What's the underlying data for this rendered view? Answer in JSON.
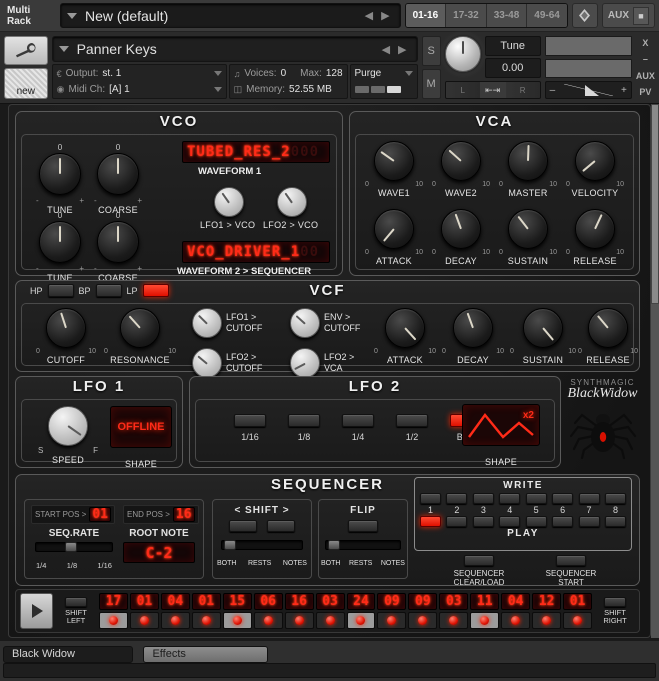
{
  "kontakt_header": {
    "multi_rack_line1": "Multi",
    "multi_rack_line2": "Rack",
    "preset_name": "New (default)",
    "prev_arrow": "◀",
    "next_arrow": "▶",
    "ranges": [
      "01-16",
      "17-32",
      "33-48",
      "49-64"
    ],
    "active_range": "01-16",
    "aux_label": "AUX"
  },
  "instrument_header": {
    "name": "Panner Keys",
    "output_key": "Output:",
    "output_value": "st. 1",
    "midi_key": "Midi Ch:",
    "midi_value": "[A] 1",
    "voices_key": "Voices:",
    "voices_value": "0",
    "max_key": "Max:",
    "max_value": "128",
    "memory_key": "Memory:",
    "memory_value": "52.55 MB",
    "purge_label": "Purge",
    "solo_label": "S",
    "mute_label": "M",
    "tune_label": "Tune",
    "tune_value": "0.00",
    "pan_left": "L",
    "pan_center": "⇤⇥",
    "pan_right": "R",
    "vol_minus": "–",
    "vol_plus": "+",
    "new_icon_label": "new",
    "rail": [
      "X",
      "–",
      "AUX",
      "PV"
    ]
  },
  "vco": {
    "title": "VCO",
    "knobs": [
      {
        "label": "TUNE",
        "top": "0",
        "min": "-",
        "max": "+"
      },
      {
        "label": "COARSE",
        "top": "0",
        "min": "-",
        "max": "+"
      },
      {
        "label": "TUNE",
        "top": "0",
        "min": "-",
        "max": "+"
      },
      {
        "label": "COARSE",
        "top": "0",
        "min": "-",
        "max": "+"
      }
    ],
    "display1": "TUBED_RES_2",
    "display1_dim": "000",
    "display1_label": "WAVEFORM 1",
    "display2": "VCO_DRIVER_1",
    "display2_dim": "00",
    "display2_label": "WAVEFORM 2  >  SEQUENCER",
    "mod_knobs": [
      {
        "label": "LFO1 > VCO"
      },
      {
        "label": "LFO2 > VCO"
      }
    ]
  },
  "vca": {
    "title": "VCA",
    "knobs": [
      {
        "label": "WAVE1",
        "min": "0",
        "max": "10"
      },
      {
        "label": "WAVE2",
        "min": "0",
        "max": "10"
      },
      {
        "label": "MASTER",
        "min": "0",
        "max": "10"
      },
      {
        "label": "VELOCITY",
        "min": "0",
        "max": "10"
      },
      {
        "label": "ATTACK",
        "min": "0",
        "max": "10"
      },
      {
        "label": "DECAY",
        "min": "0",
        "max": "10"
      },
      {
        "label": "SUSTAIN",
        "min": "0",
        "max": "10"
      },
      {
        "label": "RELEASE",
        "min": "0",
        "max": "10"
      }
    ]
  },
  "vcf": {
    "title": "VCF",
    "modes": [
      {
        "label": "HP",
        "on": false
      },
      {
        "label": "BP",
        "on": false
      },
      {
        "label": "LP",
        "on": true
      }
    ],
    "knobs": [
      {
        "label": "CUTOFF",
        "min": "0",
        "max": "10"
      },
      {
        "label": "RESONANCE",
        "min": "0",
        "max": "10"
      }
    ],
    "mod_knobs": [
      {
        "line1": "LFO1 >",
        "line2": "CUTOFF"
      },
      {
        "line1": "ENV >",
        "line2": "CUTOFF"
      },
      {
        "line1": "LFO2 >",
        "line2": "CUTOFF"
      },
      {
        "line1": "LFO2 >",
        "line2": "VCA"
      }
    ],
    "env_knobs": [
      {
        "label": "ATTACK",
        "min": "0",
        "max": "10"
      },
      {
        "label": "DECAY",
        "min": "0",
        "max": "10"
      },
      {
        "label": "SUSTAIN",
        "min": "0",
        "max": "10"
      },
      {
        "label": "RELEASE",
        "min": "0",
        "max": "10"
      }
    ]
  },
  "lfo1": {
    "title": "LFO 1",
    "speed_label": "SPEED",
    "speed_min": "S",
    "speed_max": "F",
    "shape_label": "SHAPE",
    "shape_value": "OFFLINE"
  },
  "lfo2": {
    "title": "LFO 2",
    "rates": [
      {
        "label": "1/16",
        "on": false
      },
      {
        "label": "1/8",
        "on": false
      },
      {
        "label": "1/4",
        "on": false
      },
      {
        "label": "1/2",
        "on": false
      },
      {
        "label": "BAR",
        "on": true
      }
    ],
    "shape_label": "SHAPE",
    "shape_multiplier": "x2"
  },
  "brand": {
    "company": "SYNTHMAGIC",
    "product": "BlackWidow"
  },
  "sequencer": {
    "title": "SEQUENCER",
    "start_pos_label": "START POS >",
    "start_pos_value": "01",
    "end_pos_label": "END POS >",
    "end_pos_value": "16",
    "seq_rate_label": "SEQ.RATE",
    "seq_rate_ticks": [
      "1/4",
      "1/8",
      "1/16"
    ],
    "root_note_label": "ROOT NOTE",
    "root_note_value": "C-2",
    "shift_label": "< SHIFT >",
    "flip_label": "FLIP",
    "mode_ticks": [
      "BOTH",
      "RESTS",
      "NOTES"
    ],
    "write_label": "WRITE",
    "play_label": "PLAY",
    "slot_numbers": [
      "1",
      "2",
      "3",
      "4",
      "5",
      "6",
      "7",
      "8"
    ],
    "active_play_slot": 1,
    "clear_load_line1": "SEQUENCER",
    "clear_load_line2": "CLEAR/LOAD",
    "start_line1": "SEQUENCER",
    "start_line2": "START"
  },
  "steps": {
    "shift_left_line1": "SHIFT",
    "shift_left_line2": "LEFT",
    "shift_right_line1": "SHIFT",
    "shift_right_line2": "RIGHT",
    "values": [
      "17",
      "01",
      "04",
      "01",
      "15",
      "06",
      "16",
      "03",
      "24",
      "09",
      "09",
      "03",
      "11",
      "04",
      "12",
      "01"
    ],
    "accents": [
      true,
      false,
      false,
      false,
      true,
      false,
      false,
      false,
      true,
      false,
      false,
      false,
      true,
      false,
      false,
      false
    ]
  },
  "bottom_tabs": {
    "active": "Black Widow",
    "other": "Effects"
  },
  "colors": {
    "led_red": "#ff2b18",
    "panel_bg": "#1e1e1e",
    "accent": "#e01000"
  }
}
